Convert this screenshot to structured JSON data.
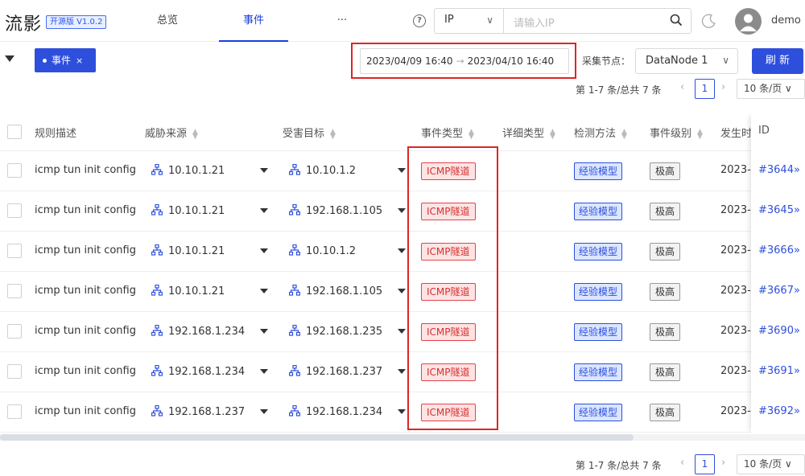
{
  "app": {
    "logo": "流影",
    "version": "开源版 V1.0.2"
  },
  "nav": {
    "items": [
      {
        "label": "总览"
      },
      {
        "label": "事件"
      },
      {
        "label": "···"
      }
    ],
    "active": "事件"
  },
  "search": {
    "type_value": "IP",
    "placeholder": "请输入IP"
  },
  "user": {
    "name": "demo"
  },
  "filter": {
    "tag_label": "事件",
    "tag_close": "×",
    "date_start": "2023/04/09 16:40",
    "date_arrow": "→",
    "date_end": "2023/04/10 16:40",
    "node_label": "采集节点：",
    "node_value": "DataNode 1",
    "refresh_label": "刷 新"
  },
  "pager": {
    "total_text": "第 1-7 条/总共 7 条",
    "prev": "‹",
    "current_page": "1",
    "next": "›",
    "page_size": "10 条/页"
  },
  "table": {
    "headers": {
      "rule": "规则描述",
      "source": "威胁来源",
      "target": "受害目标",
      "event_type": "事件类型",
      "detail_type": "详细类型",
      "method": "检测方法",
      "level": "事件级别",
      "time": "发生时",
      "id": "ID"
    },
    "rows": [
      {
        "rule": "icmp tun init config",
        "source": "10.10.1.21",
        "target": "10.10.1.2",
        "event_type": "ICMP隧道",
        "method": "经验模型",
        "level": "极高",
        "time": "2023-(",
        "id": "#3644»"
      },
      {
        "rule": "icmp tun init config",
        "source": "10.10.1.21",
        "target": "192.168.1.105",
        "event_type": "ICMP隧道",
        "method": "经验模型",
        "level": "极高",
        "time": "2023-(",
        "id": "#3645»"
      },
      {
        "rule": "icmp tun init config",
        "source": "10.10.1.21",
        "target": "10.10.1.2",
        "event_type": "ICMP隧道",
        "method": "经验模型",
        "level": "极高",
        "time": "2023-(",
        "id": "#3666»"
      },
      {
        "rule": "icmp tun init config",
        "source": "10.10.1.21",
        "target": "192.168.1.105",
        "event_type": "ICMP隧道",
        "method": "经验模型",
        "level": "极高",
        "time": "2023-(",
        "id": "#3667»"
      },
      {
        "rule": "icmp tun init config",
        "source": "192.168.1.234",
        "target": "192.168.1.235",
        "event_type": "ICMP隧道",
        "method": "经验模型",
        "level": "极高",
        "time": "2023-(",
        "id": "#3690»"
      },
      {
        "rule": "icmp tun init config",
        "source": "192.168.1.234",
        "target": "192.168.1.237",
        "event_type": "ICMP隧道",
        "method": "经验模型",
        "level": "极高",
        "time": "2023-(",
        "id": "#3691»"
      },
      {
        "rule": "icmp tun init config",
        "source": "192.168.1.237",
        "target": "192.168.1.234",
        "event_type": "ICMP隧道",
        "method": "经验模型",
        "level": "极高",
        "time": "2023-(",
        "id": "#3692»"
      }
    ]
  },
  "colors": {
    "primary": "#2e4fdc",
    "danger": "#e02424",
    "tag_red_bg": "#ffe3e3"
  },
  "icons": {
    "help": "help-circle-icon",
    "search": "search-icon",
    "theme": "moon-icon",
    "avatar": "user-avatar-icon",
    "network": "network-topology-icon",
    "sort": "sort-icon",
    "filter": "filter-icon"
  }
}
